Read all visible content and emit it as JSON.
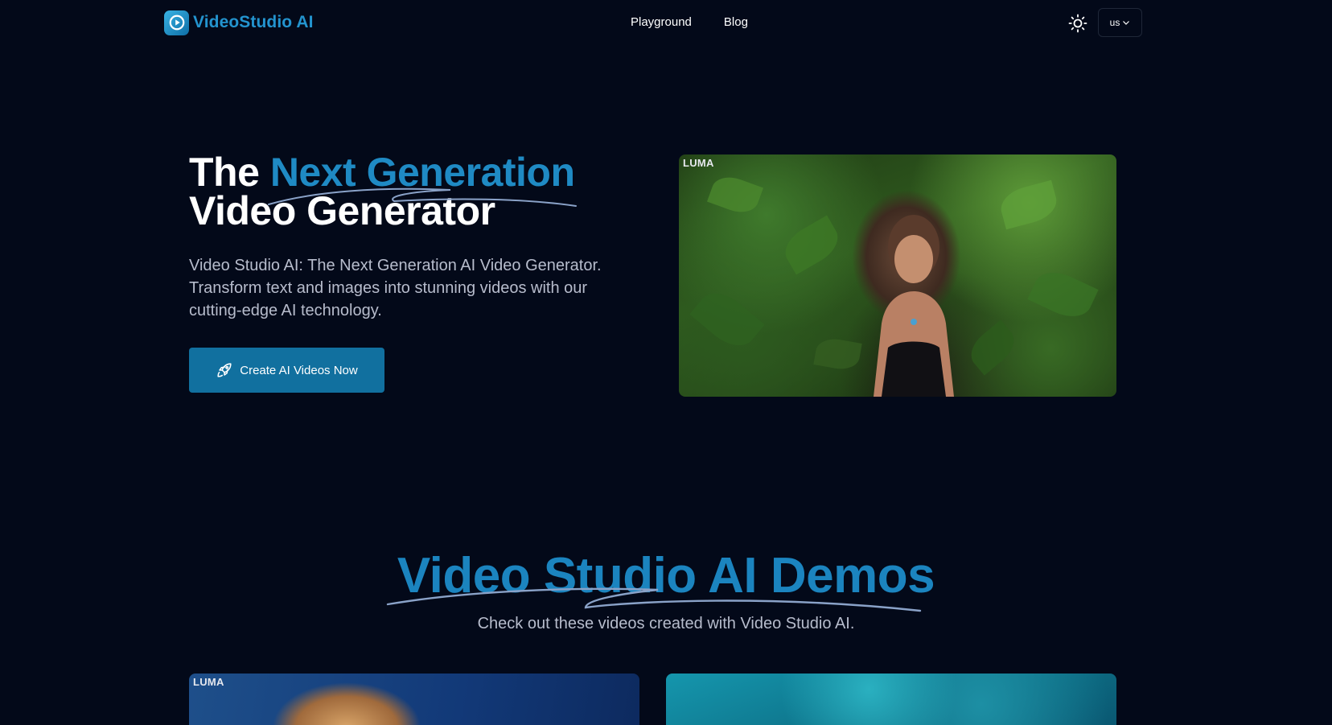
{
  "brand": {
    "name": "VideoStudio AI",
    "logo_icon": "play-circle-icon"
  },
  "nav": {
    "links": [
      {
        "label": "Playground"
      },
      {
        "label": "Blog"
      }
    ],
    "theme_icon": "sun-icon",
    "language": {
      "selected": "us"
    }
  },
  "hero": {
    "title_prefix": "The",
    "title_accent": "Next Generation",
    "title_line2": "Video Generator",
    "description": "Video Studio AI: The Next Generation AI Video Generator. Transform text and images into stunning videos with our cutting-edge AI technology.",
    "cta_label": "Create AI Videos Now",
    "cta_icon": "rocket-icon",
    "media_badge": "LUMA"
  },
  "demos": {
    "title": "Video Studio AI Demos",
    "subtitle": "Check out these videos created with Video Studio AI.",
    "cards": [
      {
        "badge": "LUMA"
      },
      {
        "badge": ""
      }
    ]
  },
  "colors": {
    "background": "#030919",
    "accent": "#1f8ac4",
    "button": "#11709f",
    "muted_text": "#b7bccc"
  }
}
